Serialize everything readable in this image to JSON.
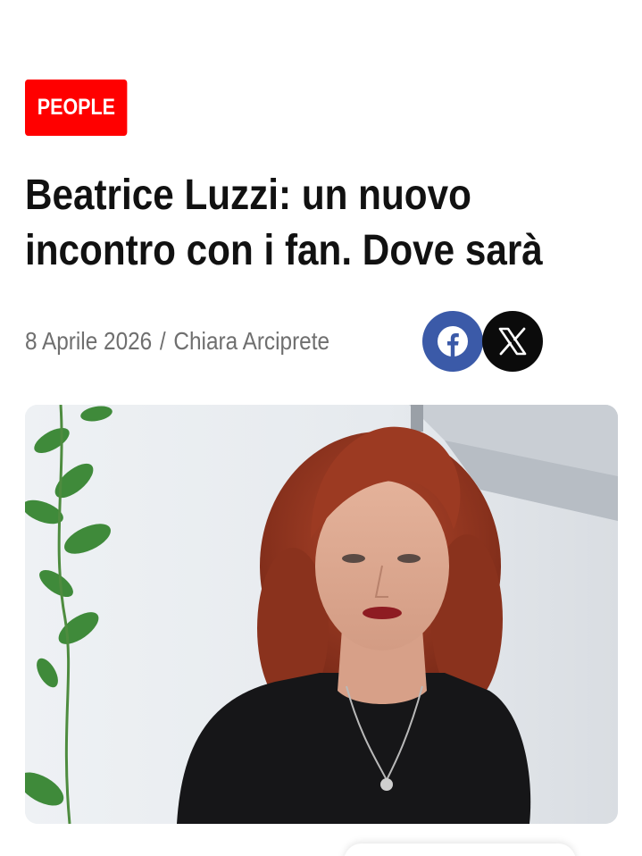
{
  "article": {
    "category": "PEOPLE",
    "headline": "Beatrice Luzzi: un nuovo incontro con i fan. Dove sarà",
    "date": "8 Aprile 2026",
    "separator": "/",
    "author": "Chiara Arciprete"
  },
  "share": {
    "buttons": [
      {
        "network": "facebook",
        "icon": "facebook-icon",
        "color": "#3b5aa8"
      },
      {
        "network": "x",
        "icon": "x-icon",
        "color": "#0b0b0b"
      }
    ]
  },
  "hero_image": {
    "subject": "portrait photo"
  },
  "colors": {
    "badge": "#ff0000",
    "headline": "#111111",
    "meta": "#6f6f6f"
  }
}
